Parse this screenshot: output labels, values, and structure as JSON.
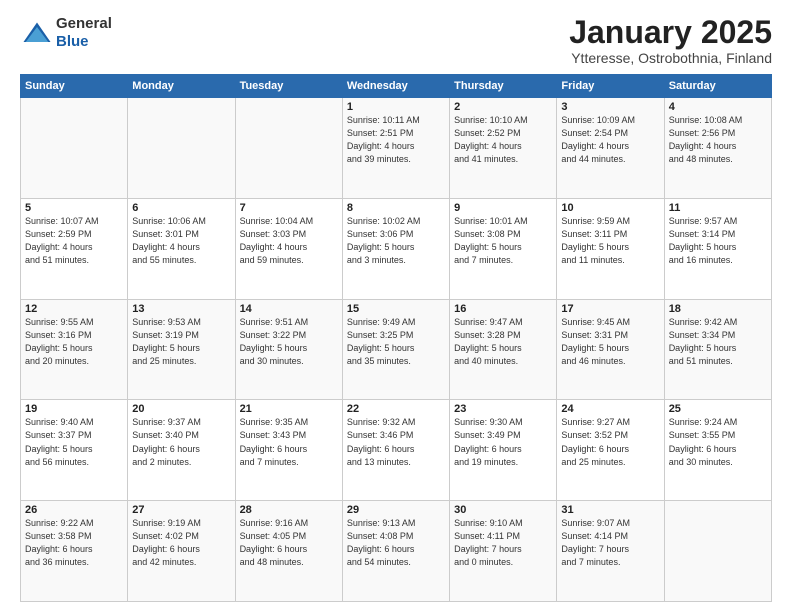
{
  "logo": {
    "general": "General",
    "blue": "Blue"
  },
  "title": "January 2025",
  "subtitle": "Ytteresse, Ostrobothnia, Finland",
  "days_of_week": [
    "Sunday",
    "Monday",
    "Tuesday",
    "Wednesday",
    "Thursday",
    "Friday",
    "Saturday"
  ],
  "weeks": [
    [
      {
        "day": "",
        "detail": ""
      },
      {
        "day": "",
        "detail": ""
      },
      {
        "day": "",
        "detail": ""
      },
      {
        "day": "1",
        "detail": "Sunrise: 10:11 AM\nSunset: 2:51 PM\nDaylight: 4 hours\nand 39 minutes."
      },
      {
        "day": "2",
        "detail": "Sunrise: 10:10 AM\nSunset: 2:52 PM\nDaylight: 4 hours\nand 41 minutes."
      },
      {
        "day": "3",
        "detail": "Sunrise: 10:09 AM\nSunset: 2:54 PM\nDaylight: 4 hours\nand 44 minutes."
      },
      {
        "day": "4",
        "detail": "Sunrise: 10:08 AM\nSunset: 2:56 PM\nDaylight: 4 hours\nand 48 minutes."
      }
    ],
    [
      {
        "day": "5",
        "detail": "Sunrise: 10:07 AM\nSunset: 2:59 PM\nDaylight: 4 hours\nand 51 minutes."
      },
      {
        "day": "6",
        "detail": "Sunrise: 10:06 AM\nSunset: 3:01 PM\nDaylight: 4 hours\nand 55 minutes."
      },
      {
        "day": "7",
        "detail": "Sunrise: 10:04 AM\nSunset: 3:03 PM\nDaylight: 4 hours\nand 59 minutes."
      },
      {
        "day": "8",
        "detail": "Sunrise: 10:02 AM\nSunset: 3:06 PM\nDaylight: 5 hours\nand 3 minutes."
      },
      {
        "day": "9",
        "detail": "Sunrise: 10:01 AM\nSunset: 3:08 PM\nDaylight: 5 hours\nand 7 minutes."
      },
      {
        "day": "10",
        "detail": "Sunrise: 9:59 AM\nSunset: 3:11 PM\nDaylight: 5 hours\nand 11 minutes."
      },
      {
        "day": "11",
        "detail": "Sunrise: 9:57 AM\nSunset: 3:14 PM\nDaylight: 5 hours\nand 16 minutes."
      }
    ],
    [
      {
        "day": "12",
        "detail": "Sunrise: 9:55 AM\nSunset: 3:16 PM\nDaylight: 5 hours\nand 20 minutes."
      },
      {
        "day": "13",
        "detail": "Sunrise: 9:53 AM\nSunset: 3:19 PM\nDaylight: 5 hours\nand 25 minutes."
      },
      {
        "day": "14",
        "detail": "Sunrise: 9:51 AM\nSunset: 3:22 PM\nDaylight: 5 hours\nand 30 minutes."
      },
      {
        "day": "15",
        "detail": "Sunrise: 9:49 AM\nSunset: 3:25 PM\nDaylight: 5 hours\nand 35 minutes."
      },
      {
        "day": "16",
        "detail": "Sunrise: 9:47 AM\nSunset: 3:28 PM\nDaylight: 5 hours\nand 40 minutes."
      },
      {
        "day": "17",
        "detail": "Sunrise: 9:45 AM\nSunset: 3:31 PM\nDaylight: 5 hours\nand 46 minutes."
      },
      {
        "day": "18",
        "detail": "Sunrise: 9:42 AM\nSunset: 3:34 PM\nDaylight: 5 hours\nand 51 minutes."
      }
    ],
    [
      {
        "day": "19",
        "detail": "Sunrise: 9:40 AM\nSunset: 3:37 PM\nDaylight: 5 hours\nand 56 minutes."
      },
      {
        "day": "20",
        "detail": "Sunrise: 9:37 AM\nSunset: 3:40 PM\nDaylight: 6 hours\nand 2 minutes."
      },
      {
        "day": "21",
        "detail": "Sunrise: 9:35 AM\nSunset: 3:43 PM\nDaylight: 6 hours\nand 7 minutes."
      },
      {
        "day": "22",
        "detail": "Sunrise: 9:32 AM\nSunset: 3:46 PM\nDaylight: 6 hours\nand 13 minutes."
      },
      {
        "day": "23",
        "detail": "Sunrise: 9:30 AM\nSunset: 3:49 PM\nDaylight: 6 hours\nand 19 minutes."
      },
      {
        "day": "24",
        "detail": "Sunrise: 9:27 AM\nSunset: 3:52 PM\nDaylight: 6 hours\nand 25 minutes."
      },
      {
        "day": "25",
        "detail": "Sunrise: 9:24 AM\nSunset: 3:55 PM\nDaylight: 6 hours\nand 30 minutes."
      }
    ],
    [
      {
        "day": "26",
        "detail": "Sunrise: 9:22 AM\nSunset: 3:58 PM\nDaylight: 6 hours\nand 36 minutes."
      },
      {
        "day": "27",
        "detail": "Sunrise: 9:19 AM\nSunset: 4:02 PM\nDaylight: 6 hours\nand 42 minutes."
      },
      {
        "day": "28",
        "detail": "Sunrise: 9:16 AM\nSunset: 4:05 PM\nDaylight: 6 hours\nand 48 minutes."
      },
      {
        "day": "29",
        "detail": "Sunrise: 9:13 AM\nSunset: 4:08 PM\nDaylight: 6 hours\nand 54 minutes."
      },
      {
        "day": "30",
        "detail": "Sunrise: 9:10 AM\nSunset: 4:11 PM\nDaylight: 7 hours\nand 0 minutes."
      },
      {
        "day": "31",
        "detail": "Sunrise: 9:07 AM\nSunset: 4:14 PM\nDaylight: 7 hours\nand 7 minutes."
      },
      {
        "day": "",
        "detail": ""
      }
    ]
  ]
}
